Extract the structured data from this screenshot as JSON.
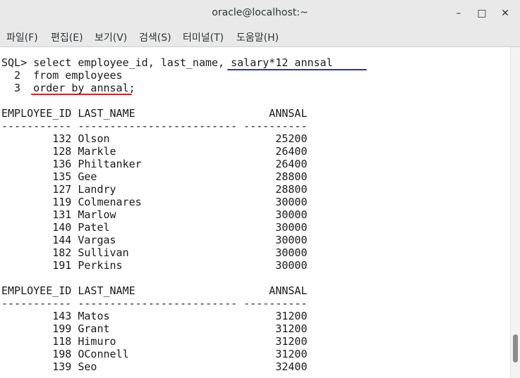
{
  "window": {
    "title": "oracle@localhost:~"
  },
  "controls": {
    "minimize": "–",
    "maximize": "□",
    "close": "✕"
  },
  "menu": [
    {
      "label": "파일(F)"
    },
    {
      "label": "편집(E)"
    },
    {
      "label": "보기(V)"
    },
    {
      "label": "검색(S)"
    },
    {
      "label": "터미널(T)"
    },
    {
      "label": "도움말(H)"
    }
  ],
  "terminal": {
    "query": [
      "SQL> select employee_id, last_name, salary*12 annsal",
      "  2  from employees",
      "  3  order by annsal;"
    ],
    "header": "EMPLOYEE_ID LAST_NAME                     ANNSAL",
    "separator": "----------- ------------------------- ----------",
    "page1": [
      "        132 Olson                          25200",
      "        128 Markle                         26400",
      "        136 Philtanker                     26400",
      "        135 Gee                            28800",
      "        127 Landry                         28800",
      "        119 Colmenares                     30000",
      "        131 Marlow                         30000",
      "        140 Patel                          30000",
      "        144 Vargas                         30000",
      "        182 Sullivan                       30000",
      "        191 Perkins                        30000"
    ],
    "page2": [
      "        143 Matos                          31200",
      "        199 Grant                          31200",
      "        118 Himuro                         31200",
      "        198 OConnell                       31200",
      "        139 Seo                            32400"
    ]
  },
  "annotations": {
    "blue": "#1f2fd6",
    "red": "#d62020"
  }
}
